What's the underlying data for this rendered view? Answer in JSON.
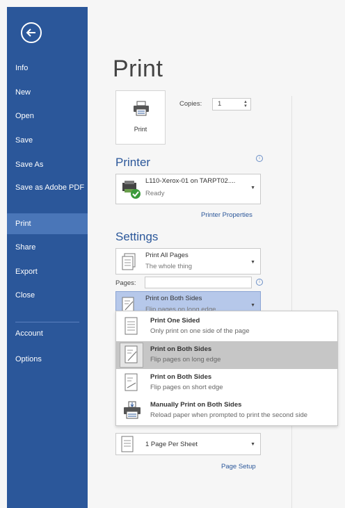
{
  "sidebar": {
    "items": [
      {
        "label": "Info"
      },
      {
        "label": "New"
      },
      {
        "label": "Open"
      },
      {
        "label": "Save"
      },
      {
        "label": "Save As"
      },
      {
        "label": "Save as Adobe PDF"
      },
      {
        "label": "Print"
      },
      {
        "label": "Share"
      },
      {
        "label": "Export"
      },
      {
        "label": "Close"
      },
      {
        "label": "Account"
      },
      {
        "label": "Options"
      }
    ],
    "active": "Print",
    "color": "#2b579a"
  },
  "main": {
    "title": "Print",
    "print_button_label": "Print",
    "copies_label": "Copies:",
    "copies_value": "1",
    "printer_heading": "Printer",
    "printer": {
      "name": "L110-Xerox-01 on TARPT02....",
      "status": "Ready"
    },
    "printer_properties_link": "Printer Properties",
    "settings_heading": "Settings",
    "pages_setting": {
      "title": "Print All Pages",
      "subtitle": "The whole thing"
    },
    "pages_label": "Pages:",
    "pages_value": "",
    "duplex_setting": {
      "title": "Print on Both Sides",
      "subtitle": "Flip pages on long edge"
    },
    "per_sheet_setting": {
      "title": "1 Page Per Sheet"
    },
    "page_setup_link": "Page Setup"
  },
  "duplex_menu": {
    "options": [
      {
        "title": "Print One Sided",
        "subtitle": "Only print on one side of the page"
      },
      {
        "title": "Print on Both Sides",
        "subtitle": "Flip pages on long edge"
      },
      {
        "title": "Print on Both Sides",
        "subtitle": "Flip pages on short edge"
      },
      {
        "title": "Manually Print on Both Sides",
        "subtitle": "Reload paper when prompted to print the second side"
      }
    ],
    "highlighted": "Print on Both Sides"
  }
}
